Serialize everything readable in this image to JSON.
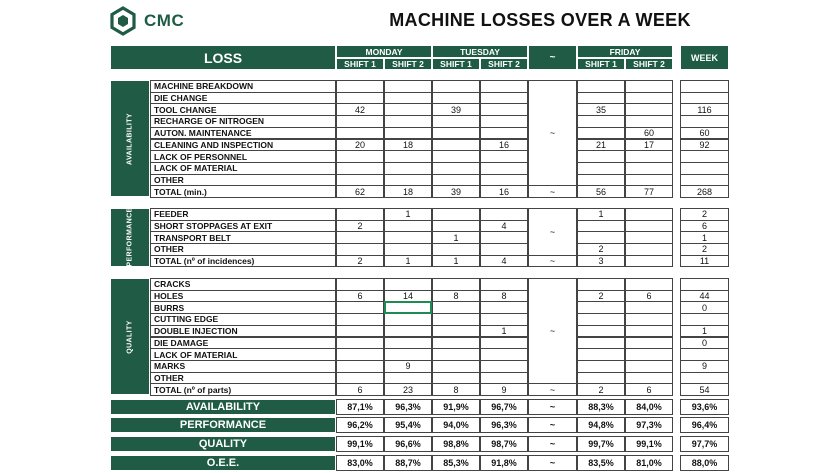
{
  "header": {
    "brand": "CMC",
    "title": "MACHINE LOSSES OVER A WEEK"
  },
  "logo_icon": "cmc-hexagon-logo-icon",
  "colors": {
    "accent": "#1f5b45",
    "selected_cell": "#1f8a52"
  },
  "table_header": {
    "loss": "LOSS",
    "days": [
      {
        "label": "MONDAY",
        "shifts": [
          "SHIFT 1",
          "SHIFT 2"
        ]
      },
      {
        "label": "TUESDAY",
        "shifts": [
          "SHIFT 1",
          "SHIFT 2"
        ]
      },
      {
        "label": "~",
        "shifts": []
      },
      {
        "label": "FRIDAY",
        "shifts": [
          "SHIFT 1",
          "SHIFT 2"
        ]
      }
    ],
    "week": "WEEK"
  },
  "sections": [
    {
      "label": "AVAILABILITY",
      "rows": [
        {
          "label": "MACHINE BREAKDOWN",
          "values": [
            "",
            "",
            "",
            "",
            "",
            ""
          ],
          "week": ""
        },
        {
          "label": "DIE CHANGE",
          "values": [
            "",
            "",
            "",
            "",
            "",
            ""
          ],
          "week": ""
        },
        {
          "label": "TOOL CHANGE",
          "values": [
            "42",
            "",
            "39",
            "",
            "35",
            ""
          ],
          "week": "116"
        },
        {
          "label": "RECHARGE OF NITROGEN",
          "values": [
            "",
            "",
            "",
            "",
            "",
            ""
          ],
          "week": ""
        },
        {
          "label": "AUTON. MAINTENANCE",
          "values": [
            "",
            "",
            "",
            "",
            "",
            "60"
          ],
          "week": "60"
        },
        {
          "label": "CLEANING AND INSPECTION",
          "values": [
            "20",
            "18",
            "",
            "16",
            "21",
            "17"
          ],
          "week": "92"
        },
        {
          "label": "LACK OF PERSONNEL",
          "values": [
            "",
            "",
            "",
            "",
            "",
            ""
          ],
          "week": ""
        },
        {
          "label": "LACK OF MATERIAL",
          "values": [
            "",
            "",
            "",
            "",
            "",
            ""
          ],
          "week": ""
        },
        {
          "label": "OTHER",
          "values": [
            "",
            "",
            "",
            "",
            "",
            ""
          ],
          "week": ""
        }
      ],
      "total": {
        "label": "TOTAL (min.)",
        "values": [
          "62",
          "18",
          "39",
          "16",
          "56",
          "77"
        ],
        "week": "268"
      }
    },
    {
      "label": "PERFORMANCE",
      "rows": [
        {
          "label": "FEEDER",
          "values": [
            "",
            "1",
            "",
            "",
            "1",
            ""
          ],
          "week": "2"
        },
        {
          "label": "SHORT STOPPAGES AT EXIT",
          "values": [
            "2",
            "",
            "",
            "4",
            "",
            ""
          ],
          "week": "6"
        },
        {
          "label": "TRANSPORT BELT",
          "values": [
            "",
            "",
            "1",
            "",
            "",
            ""
          ],
          "week": "1"
        },
        {
          "label": "OTHER",
          "values": [
            "",
            "",
            "",
            "",
            "2",
            ""
          ],
          "week": "2"
        }
      ],
      "total": {
        "label": "TOTAL (nº of incidences)",
        "values": [
          "2",
          "1",
          "1",
          "4",
          "3",
          ""
        ],
        "week": "11"
      }
    },
    {
      "label": "QUALITY",
      "rows": [
        {
          "label": "CRACKS",
          "values": [
            "",
            "",
            "",
            "",
            "",
            ""
          ],
          "week": ""
        },
        {
          "label": "HOLES",
          "values": [
            "6",
            "14",
            "8",
            "8",
            "2",
            "6"
          ],
          "week": "44"
        },
        {
          "label": "BURRS",
          "values": [
            "",
            "",
            "",
            "",
            "",
            ""
          ],
          "week": "0"
        },
        {
          "label": "CUTTING EDGE",
          "values": [
            "",
            "",
            "",
            "",
            "",
            ""
          ],
          "week": ""
        },
        {
          "label": "DOUBLE INJECTION",
          "values": [
            "",
            "",
            "",
            "1",
            "",
            ""
          ],
          "week": "1"
        },
        {
          "label": "DIE DAMAGE",
          "values": [
            "",
            "",
            "",
            "",
            "",
            ""
          ],
          "week": "0"
        },
        {
          "label": "LACK OF MATERIAL",
          "values": [
            "",
            "",
            "",
            "",
            "",
            ""
          ],
          "week": ""
        },
        {
          "label": "MARKS",
          "values": [
            "",
            "9",
            "",
            "",
            "",
            ""
          ],
          "week": "9"
        },
        {
          "label": "OTHER",
          "values": [
            "",
            "",
            "",
            "",
            "",
            ""
          ],
          "week": ""
        }
      ],
      "total": {
        "label": "TOTAL (nº of parts)",
        "values": [
          "6",
          "23",
          "8",
          "9",
          "2",
          "6"
        ],
        "week": "54"
      }
    }
  ],
  "tilde": "~",
  "kpis": [
    {
      "label": "AVAILABILITY",
      "values": [
        "87,1%",
        "96,3%",
        "91,9%",
        "96,7%",
        "88,3%",
        "84,0%"
      ],
      "week": "93,6%"
    },
    {
      "label": "PERFORMANCE",
      "values": [
        "96,2%",
        "95,4%",
        "94,0%",
        "96,3%",
        "94,8%",
        "97,3%"
      ],
      "week": "96,4%"
    },
    {
      "label": "QUALITY",
      "values": [
        "99,1%",
        "96,6%",
        "98,8%",
        "98,7%",
        "99,7%",
        "99,1%"
      ],
      "week": "97,7%"
    },
    {
      "label": "O.E.E.",
      "values": [
        "83,0%",
        "88,7%",
        "85,3%",
        "91,8%",
        "83,5%",
        "81,0%"
      ],
      "week": "88,0%"
    }
  ]
}
